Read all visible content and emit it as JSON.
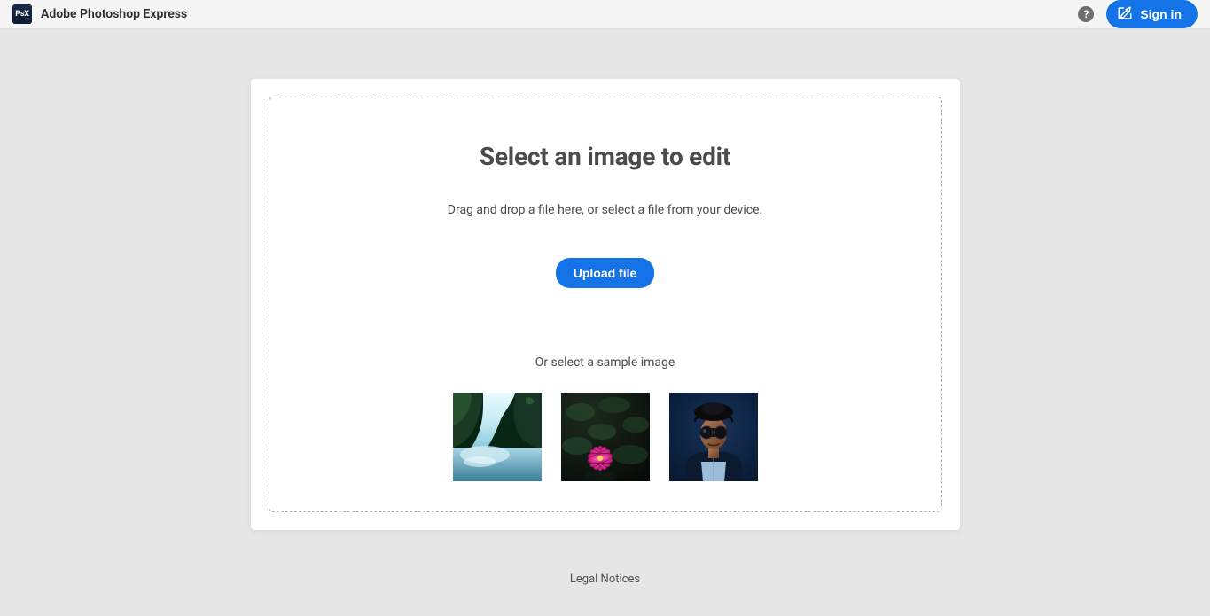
{
  "header": {
    "logo_text": "PsX",
    "app_title": "Adobe Photoshop Express",
    "help_glyph": "?",
    "signin_label": "Sign in"
  },
  "dropzone": {
    "title": "Select an image to edit",
    "subtitle": "Drag and drop a file here, or select a file from your device.",
    "upload_label": "Upload file",
    "sample_label": "Or select a sample image",
    "samples": [
      {
        "name": "waterfall"
      },
      {
        "name": "lotus"
      },
      {
        "name": "portrait"
      }
    ]
  },
  "footer": {
    "legal_label": "Legal Notices"
  }
}
